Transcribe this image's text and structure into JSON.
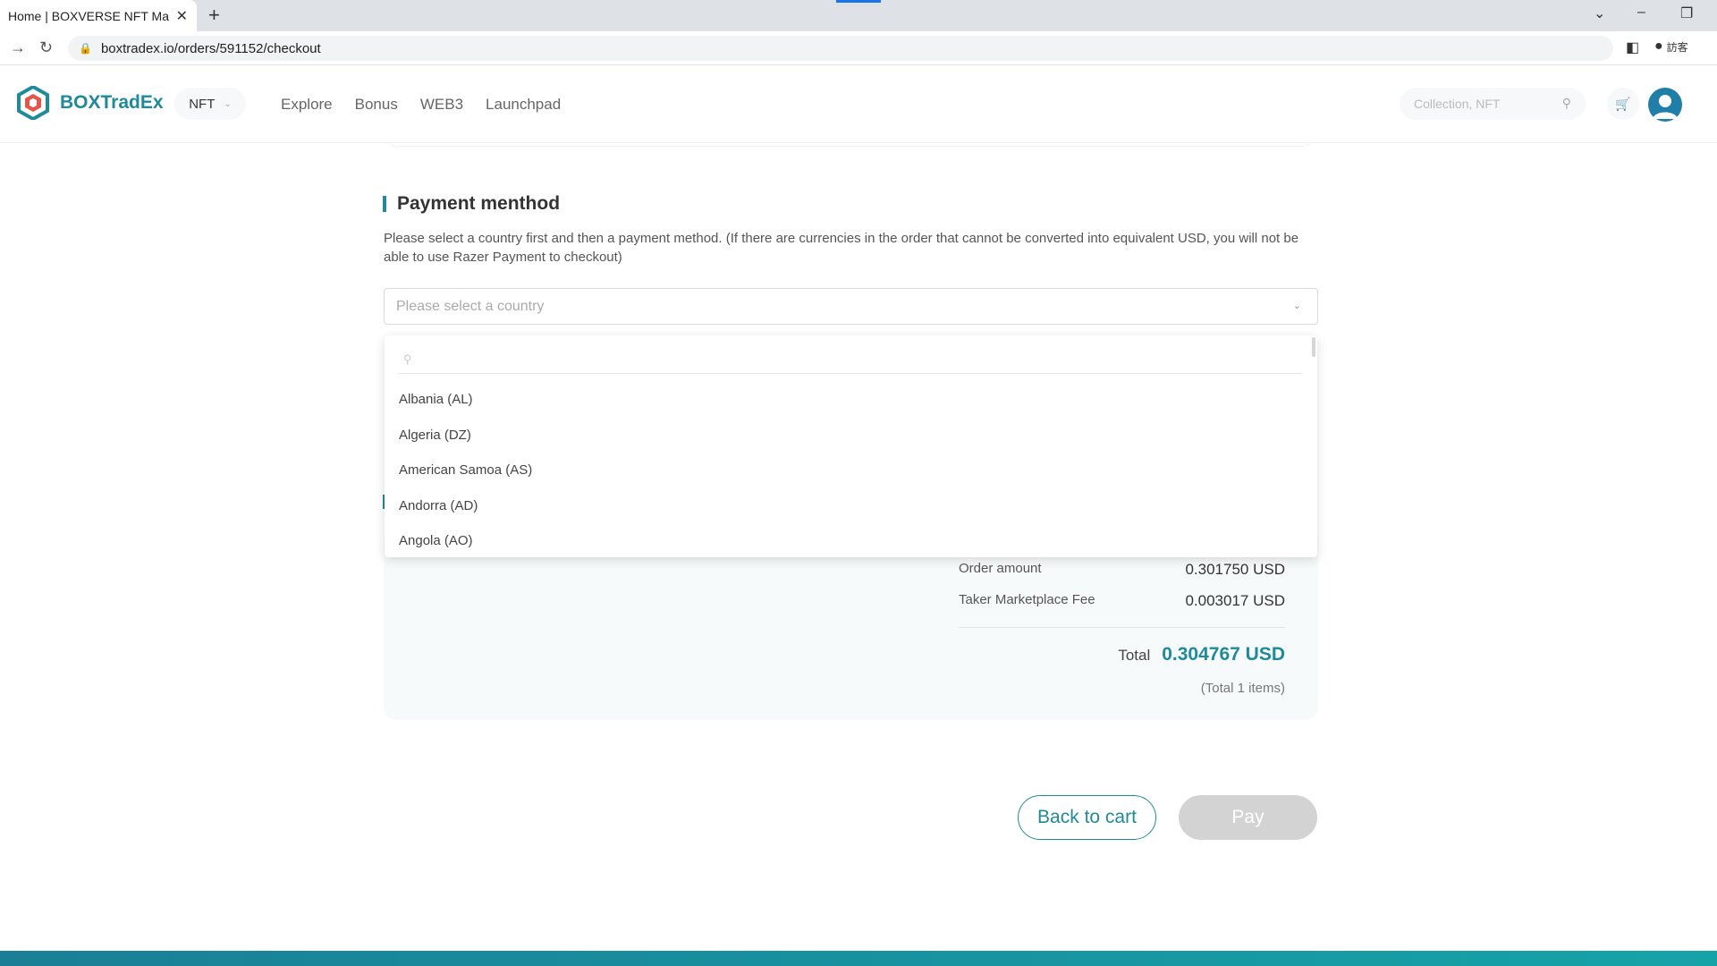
{
  "browser": {
    "tab_title": "Home | BOXVERSE NFT Marketplace",
    "tab_close": "✕",
    "new_tab": "+",
    "url": "boxtradex.io/orders/591152/checkout",
    "profile_label": "訪客"
  },
  "header": {
    "brand": "BOXTradEx",
    "nft_select": "NFT",
    "nav": [
      "Explore",
      "Bonus",
      "WEB3",
      "Launchpad"
    ],
    "search_placeholder": "Collection, NFT"
  },
  "payment": {
    "title": "Payment menthod",
    "description": "Please select a country first and then a payment method. (If there are currencies in the order that cannot be converted into equivalent USD, you will not be able to use Razer Payment to checkout)",
    "country_placeholder": "Please select a country",
    "dropdown_options": [
      "Albania (AL)",
      "Algeria (DZ)",
      "American Samoa (AS)",
      "Andorra (AD)",
      "Angola (AO)"
    ]
  },
  "summary": {
    "order_amount_label": "Order amount",
    "order_amount_value": "0.301750 USD",
    "fee_label": "Taker Marketplace Fee",
    "fee_value": "0.003017 USD",
    "total_label": "Total",
    "total_value": "0.304767 USD",
    "items_note": "(Total 1 items)"
  },
  "actions": {
    "back_label": "Back to cart",
    "pay_label": "Pay"
  },
  "colors": {
    "accent": "#1f8a99",
    "disabled_button": "#d3d3d3"
  }
}
